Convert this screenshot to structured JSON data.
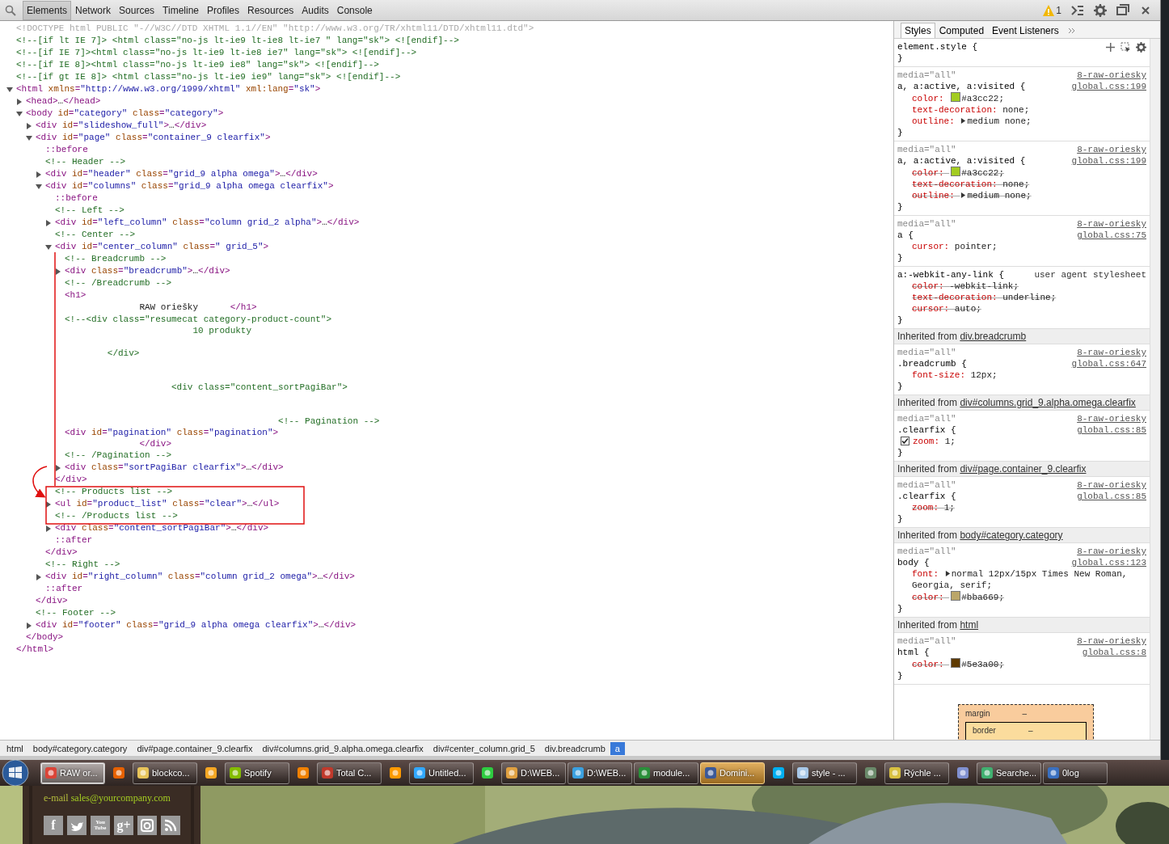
{
  "toolbar": {
    "tabs": [
      {
        "label": "Elements",
        "selected": true
      },
      {
        "label": "Network",
        "selected": false
      },
      {
        "label": "Sources",
        "selected": false
      },
      {
        "label": "Timeline",
        "selected": false
      },
      {
        "label": "Profiles",
        "selected": false
      },
      {
        "label": "Resources",
        "selected": false
      },
      {
        "label": "Audits",
        "selected": false
      },
      {
        "label": "Console",
        "selected": false
      }
    ],
    "warning_count": "1"
  },
  "dom_tree": [
    {
      "kind": "doctype",
      "text": "<!DOCTYPE html PUBLIC \"-//W3C//DTD XHTML 1.1//EN\" \"http://www.w3.org/TR/xhtml11/DTD/xhtml11.dtd\">"
    },
    {
      "kind": "comment",
      "text": "<!--[if lt IE 7]> <html class=\"no-js lt-ie9 lt-ie8 lt-ie7 \" lang=\"sk\"> <![endif]-->"
    },
    {
      "kind": "comment",
      "text": "<!--[if IE 7]><html class=\"no-js lt-ie9 lt-ie8 ie7\" lang=\"sk\"> <![endif]-->"
    },
    {
      "kind": "comment",
      "text": "<!--[if IE 8]><html class=\"no-js lt-ie9 ie8\" lang=\"sk\"> <![endif]-->"
    },
    {
      "kind": "comment",
      "text": "<!--[if gt IE 8]> <html class=\"no-js lt-ie9 ie9\" lang=\"sk\"> <![endif]-->"
    },
    {
      "kind": "element",
      "text": "<html xmlns=\"http://www.w3.org/1999/xhtml\" xml:lang=\"sk\">",
      "expanded": true,
      "close": "</html>",
      "children": [
        {
          "kind": "element",
          "text": "<head>…</head>",
          "expanded": false
        },
        {
          "kind": "element",
          "text": "<body id=\"category\" class=\"category\">",
          "expanded": true,
          "close": "</body>",
          "children": [
            {
              "kind": "element",
              "text": "<div id=\"slideshow_full\">…</div>",
              "expanded": false
            },
            {
              "kind": "element",
              "text": "<div id=\"page\" class=\"container_9 clearfix\">",
              "expanded": true,
              "close": "</div>",
              "children": [
                {
                  "kind": "pseudo",
                  "text": "::before"
                },
                {
                  "kind": "comment",
                  "text": "<!-- Header -->"
                },
                {
                  "kind": "element",
                  "text": "<div id=\"header\" class=\"grid_9 alpha omega\">…</div>",
                  "expanded": false
                },
                {
                  "kind": "element",
                  "text": "<div id=\"columns\" class=\"grid_9 alpha omega clearfix\">",
                  "expanded": true,
                  "close": "</div>",
                  "children": [
                    {
                      "kind": "pseudo",
                      "text": "::before"
                    },
                    {
                      "kind": "comment",
                      "text": "<!-- Left -->"
                    },
                    {
                      "kind": "element",
                      "text": "<div id=\"left_column\" class=\"column grid_2 alpha\">…</div>",
                      "expanded": false
                    },
                    {
                      "kind": "comment",
                      "text": "<!-- Center -->"
                    },
                    {
                      "kind": "element",
                      "text": "<div id=\"center_column\" class=\" grid_5\">",
                      "expanded": true,
                      "close": "</div>",
                      "children": [
                        {
                          "kind": "comment",
                          "text": "<!-- Breadcrumb -->"
                        },
                        {
                          "kind": "element",
                          "text": "<div class=\"breadcrumb\">…</div>",
                          "expanded": false
                        },
                        {
                          "kind": "comment",
                          "text": "<!-- /Breadcrumb -->"
                        },
                        {
                          "kind": "element",
                          "text": "<h1>"
                        },
                        {
                          "kind": "element",
                          "text": "              RAW oriešky      </h1>"
                        },
                        {
                          "kind": "comment",
                          "text": "<!--<div class=\"resumecat category-product-count\">\n                        10 produkty\n\n        </div>\n\n\n                    <div class=\"content_sortPagiBar\">\n\n\n                                        <!-- Pagination -->"
                        },
                        {
                          "kind": "element",
                          "text": "<div id=\"pagination\" class=\"pagination\">\n              </div>"
                        },
                        {
                          "kind": "comment",
                          "text": "<!-- /Pagination -->"
                        },
                        {
                          "kind": "element",
                          "text": "<div class=\"sortPagiBar clearfix\">…</div>",
                          "expanded": false
                        }
                      ]
                    },
                    {
                      "kind": "comment",
                      "text": "<!-- Products list -->"
                    },
                    {
                      "kind": "element",
                      "text": "<ul id=\"product_list\" class=\"clear\">…</ul>",
                      "expanded": false
                    },
                    {
                      "kind": "comment",
                      "text": "<!-- /Products list -->"
                    },
                    {
                      "kind": "element",
                      "text": "<div class=\"content_sortPagiBar\">…</div>",
                      "expanded": false
                    },
                    {
                      "kind": "pseudo",
                      "text": "::after"
                    }
                  ]
                },
                {
                  "kind": "comment",
                  "text": "<!-- Right -->"
                },
                {
                  "kind": "element",
                  "text": "<div id=\"right_column\" class=\"column grid_2 omega\">…</div>",
                  "expanded": false
                },
                {
                  "kind": "pseudo",
                  "text": "::after"
                }
              ]
            },
            {
              "kind": "comment",
              "text": "<!-- Footer -->"
            },
            {
              "kind": "element",
              "text": "<div id=\"footer\" class=\"grid_9 alpha omega clearfix\">…</div>",
              "expanded": false
            }
          ]
        }
      ]
    }
  ],
  "breadcrumbs": [
    {
      "label": "html",
      "selected": false
    },
    {
      "label": "body#category.category",
      "selected": false
    },
    {
      "label": "div#page.container_9.clearfix",
      "selected": false
    },
    {
      "label": "div#columns.grid_9.alpha.omega.clearfix",
      "selected": false
    },
    {
      "label": "div#center_column.grid_5",
      "selected": false
    },
    {
      "label": "div.breadcrumb",
      "selected": false
    },
    {
      "label": "a",
      "selected": true
    }
  ],
  "styles_pane": {
    "tabs": [
      {
        "label": "Styles",
        "selected": true
      },
      {
        "label": "Computed",
        "selected": false
      },
      {
        "label": "Event Listeners",
        "selected": false
      }
    ],
    "sections": [
      {
        "kind": "element",
        "selector": "element.style {",
        "close": "}"
      },
      {
        "kind": "rule",
        "media": "media=\"all\"",
        "selector": "a, a:active, a:visited {",
        "source": [
          "8-raw-oriesky",
          "global.css:199"
        ],
        "close": "}",
        "props": [
          {
            "kind": "color",
            "name": "color:",
            "value": "#a3cc22;",
            "struck": false,
            "expandable": false,
            "hovered": false
          },
          {
            "kind": "plain",
            "name": "text-decoration:",
            "value": "none;",
            "struck": false,
            "expandable": false,
            "hovered": false
          },
          {
            "kind": "plain",
            "name": "outline:",
            "value": "medium none;",
            "struck": false,
            "expandable": true,
            "hovered": false
          }
        ]
      },
      {
        "kind": "rule",
        "media": "media=\"all\"",
        "selector": "a, a:active, a:visited {",
        "source": [
          "8-raw-oriesky",
          "global.css:199"
        ],
        "close": "}",
        "props": [
          {
            "kind": "color",
            "name": "color:",
            "value": "#a3cc22;",
            "struck": true,
            "expandable": false,
            "hovered": false
          },
          {
            "kind": "plain",
            "name": "text-decoration:",
            "value": "none;",
            "struck": true,
            "expandable": false,
            "hovered": false
          },
          {
            "kind": "plain",
            "name": "outline:",
            "value": "medium none;",
            "struck": true,
            "expandable": true,
            "hovered": false
          }
        ]
      },
      {
        "kind": "rule",
        "media": "media=\"all\"",
        "selector": "a {",
        "source": [
          "8-raw-oriesky",
          "global.css:75"
        ],
        "close": "}",
        "props": [
          {
            "kind": "plain",
            "name": "cursor:",
            "value": "pointer;",
            "struck": false,
            "expandable": false,
            "hovered": false
          }
        ]
      },
      {
        "kind": "rule",
        "selector": "a:-webkit-any-link {",
        "origin": "user agent stylesheet",
        "close": "}",
        "props": [
          {
            "kind": "plain",
            "name": "color:",
            "value": "-webkit-link;",
            "struck": true,
            "expandable": false,
            "hovered": false
          },
          {
            "kind": "plain",
            "name": "text-decoration:",
            "value": "underline;",
            "struck": true,
            "expandable": false,
            "hovered": false
          },
          {
            "kind": "plain",
            "name": "cursor:",
            "value": "auto;",
            "struck": true,
            "expandable": false,
            "hovered": false
          }
        ]
      },
      {
        "kind": "inherited",
        "label": "Inherited from",
        "link": "div.breadcrumb"
      },
      {
        "kind": "rule",
        "media": "media=\"all\"",
        "selector": ".breadcrumb {",
        "source": [
          "8-raw-oriesky",
          "global.css:647"
        ],
        "close": "}",
        "props": [
          {
            "kind": "plain",
            "name": "font-size:",
            "value": "12px;",
            "struck": false,
            "expandable": false,
            "hovered": false
          }
        ]
      },
      {
        "kind": "inherited",
        "label": "Inherited from",
        "link": "div#columns.grid_9.alpha.omega.clearfix"
      },
      {
        "kind": "rule",
        "media": "media=\"all\"",
        "selector": ".clearfix {",
        "source": [
          "8-raw-oriesky",
          "global.css:85"
        ],
        "close": "}",
        "props": [
          {
            "kind": "plain",
            "name": "zoom:",
            "value": "1;",
            "struck": false,
            "expandable": false,
            "hovered": true
          }
        ]
      },
      {
        "kind": "inherited",
        "label": "Inherited from",
        "link": "div#page.container_9.clearfix"
      },
      {
        "kind": "rule",
        "media": "media=\"all\"",
        "selector": ".clearfix {",
        "source": [
          "8-raw-oriesky",
          "global.css:85"
        ],
        "close": "}",
        "props": [
          {
            "kind": "plain",
            "name": "zoom:",
            "value": "1;",
            "struck": true,
            "expandable": false,
            "hovered": false
          }
        ]
      },
      {
        "kind": "inherited",
        "label": "Inherited from",
        "link": "body#category.category"
      },
      {
        "kind": "rule",
        "media": "media=\"all\"",
        "selector": "body {",
        "source": [
          "8-raw-oriesky",
          "global.css:123"
        ],
        "close": "}",
        "props": [
          {
            "kind": "plain",
            "name": "font:",
            "value": "normal 12px/15px Times New Roman, Georgia, serif;",
            "struck": false,
            "expandable": true,
            "hovered": false
          },
          {
            "kind": "color",
            "name": "color:",
            "value": "#bba669;",
            "struck": true,
            "expandable": false,
            "hovered": false
          }
        ]
      },
      {
        "kind": "inherited",
        "label": "Inherited from",
        "link": "html"
      },
      {
        "kind": "rule",
        "media": "media=\"all\"",
        "selector": "html {",
        "source": [
          "8-raw-oriesky",
          "global.css:8"
        ],
        "close": "}",
        "props": [
          {
            "kind": "color",
            "name": "color:",
            "value": "#5e3a00;",
            "struck": true,
            "expandable": false,
            "hovered": false
          }
        ]
      }
    ],
    "box_model": {
      "margin_label": "margin",
      "margin_value": "–",
      "border_label": "border",
      "border_value": "–"
    }
  },
  "taskbar": {
    "items": [
      {
        "label": "RAW or...",
        "color": "#db4437",
        "selected": true,
        "attention": false
      },
      {
        "color": "#e66000",
        "selected": false,
        "attention": false
      },
      {
        "label": "blockco...",
        "color": "#e8c45a",
        "selected": false,
        "attention": false
      },
      {
        "color": "#f5a623",
        "selected": false,
        "attention": false
      },
      {
        "label": "Spotify",
        "color": "#84bd00",
        "selected": false,
        "attention": false
      },
      {
        "color": "#f08000",
        "selected": false,
        "attention": false
      },
      {
        "label": "Total C...",
        "color": "#c0392b",
        "selected": false,
        "attention": false
      },
      {
        "color": "#ff9a00",
        "selected": false,
        "attention": false
      },
      {
        "label": "Untitled...",
        "color": "#31a8ff",
        "selected": false,
        "attention": false
      },
      {
        "color": "#2ecc40",
        "selected": false,
        "attention": false
      },
      {
        "label": "D:\\WEB...",
        "color": "#e0a040",
        "selected": false,
        "attention": false
      },
      {
        "label": "D:\\WEB...",
        "color": "#3aa0e0",
        "selected": false,
        "attention": false
      },
      {
        "label": "module...",
        "color": "#2a8f3a",
        "selected": false,
        "attention": false
      },
      {
        "label": "Domini...",
        "color": "#3b5998",
        "selected": false,
        "attention": true
      },
      {
        "color": "#00aff0",
        "selected": false,
        "attention": false
      },
      {
        "label": "style - ...",
        "color": "#a8c8e8",
        "selected": false,
        "attention": false
      },
      {
        "color": "#6a8a6a",
        "selected": false,
        "attention": false
      },
      {
        "label": "Rýchle ...",
        "color": "#d8c040",
        "selected": false,
        "attention": false
      },
      {
        "color": "#8090d0",
        "selected": false,
        "attention": false
      },
      {
        "label": "Searche...",
        "color": "#40b070",
        "selected": false,
        "attention": false
      },
      {
        "label": "0log",
        "color": "#3a70c0",
        "selected": false,
        "attention": false
      }
    ]
  },
  "web_page": {
    "email_label": "e-mail",
    "email_link": "sales@yourcompany.com",
    "social_icons": [
      {
        "kind": "letter",
        "text": "f"
      },
      {
        "kind": "bird"
      },
      {
        "kind": "letter",
        "text": "You\nTube"
      },
      {
        "kind": "letter",
        "text": "g+"
      },
      {
        "kind": "camera"
      },
      {
        "kind": "rss"
      }
    ]
  }
}
